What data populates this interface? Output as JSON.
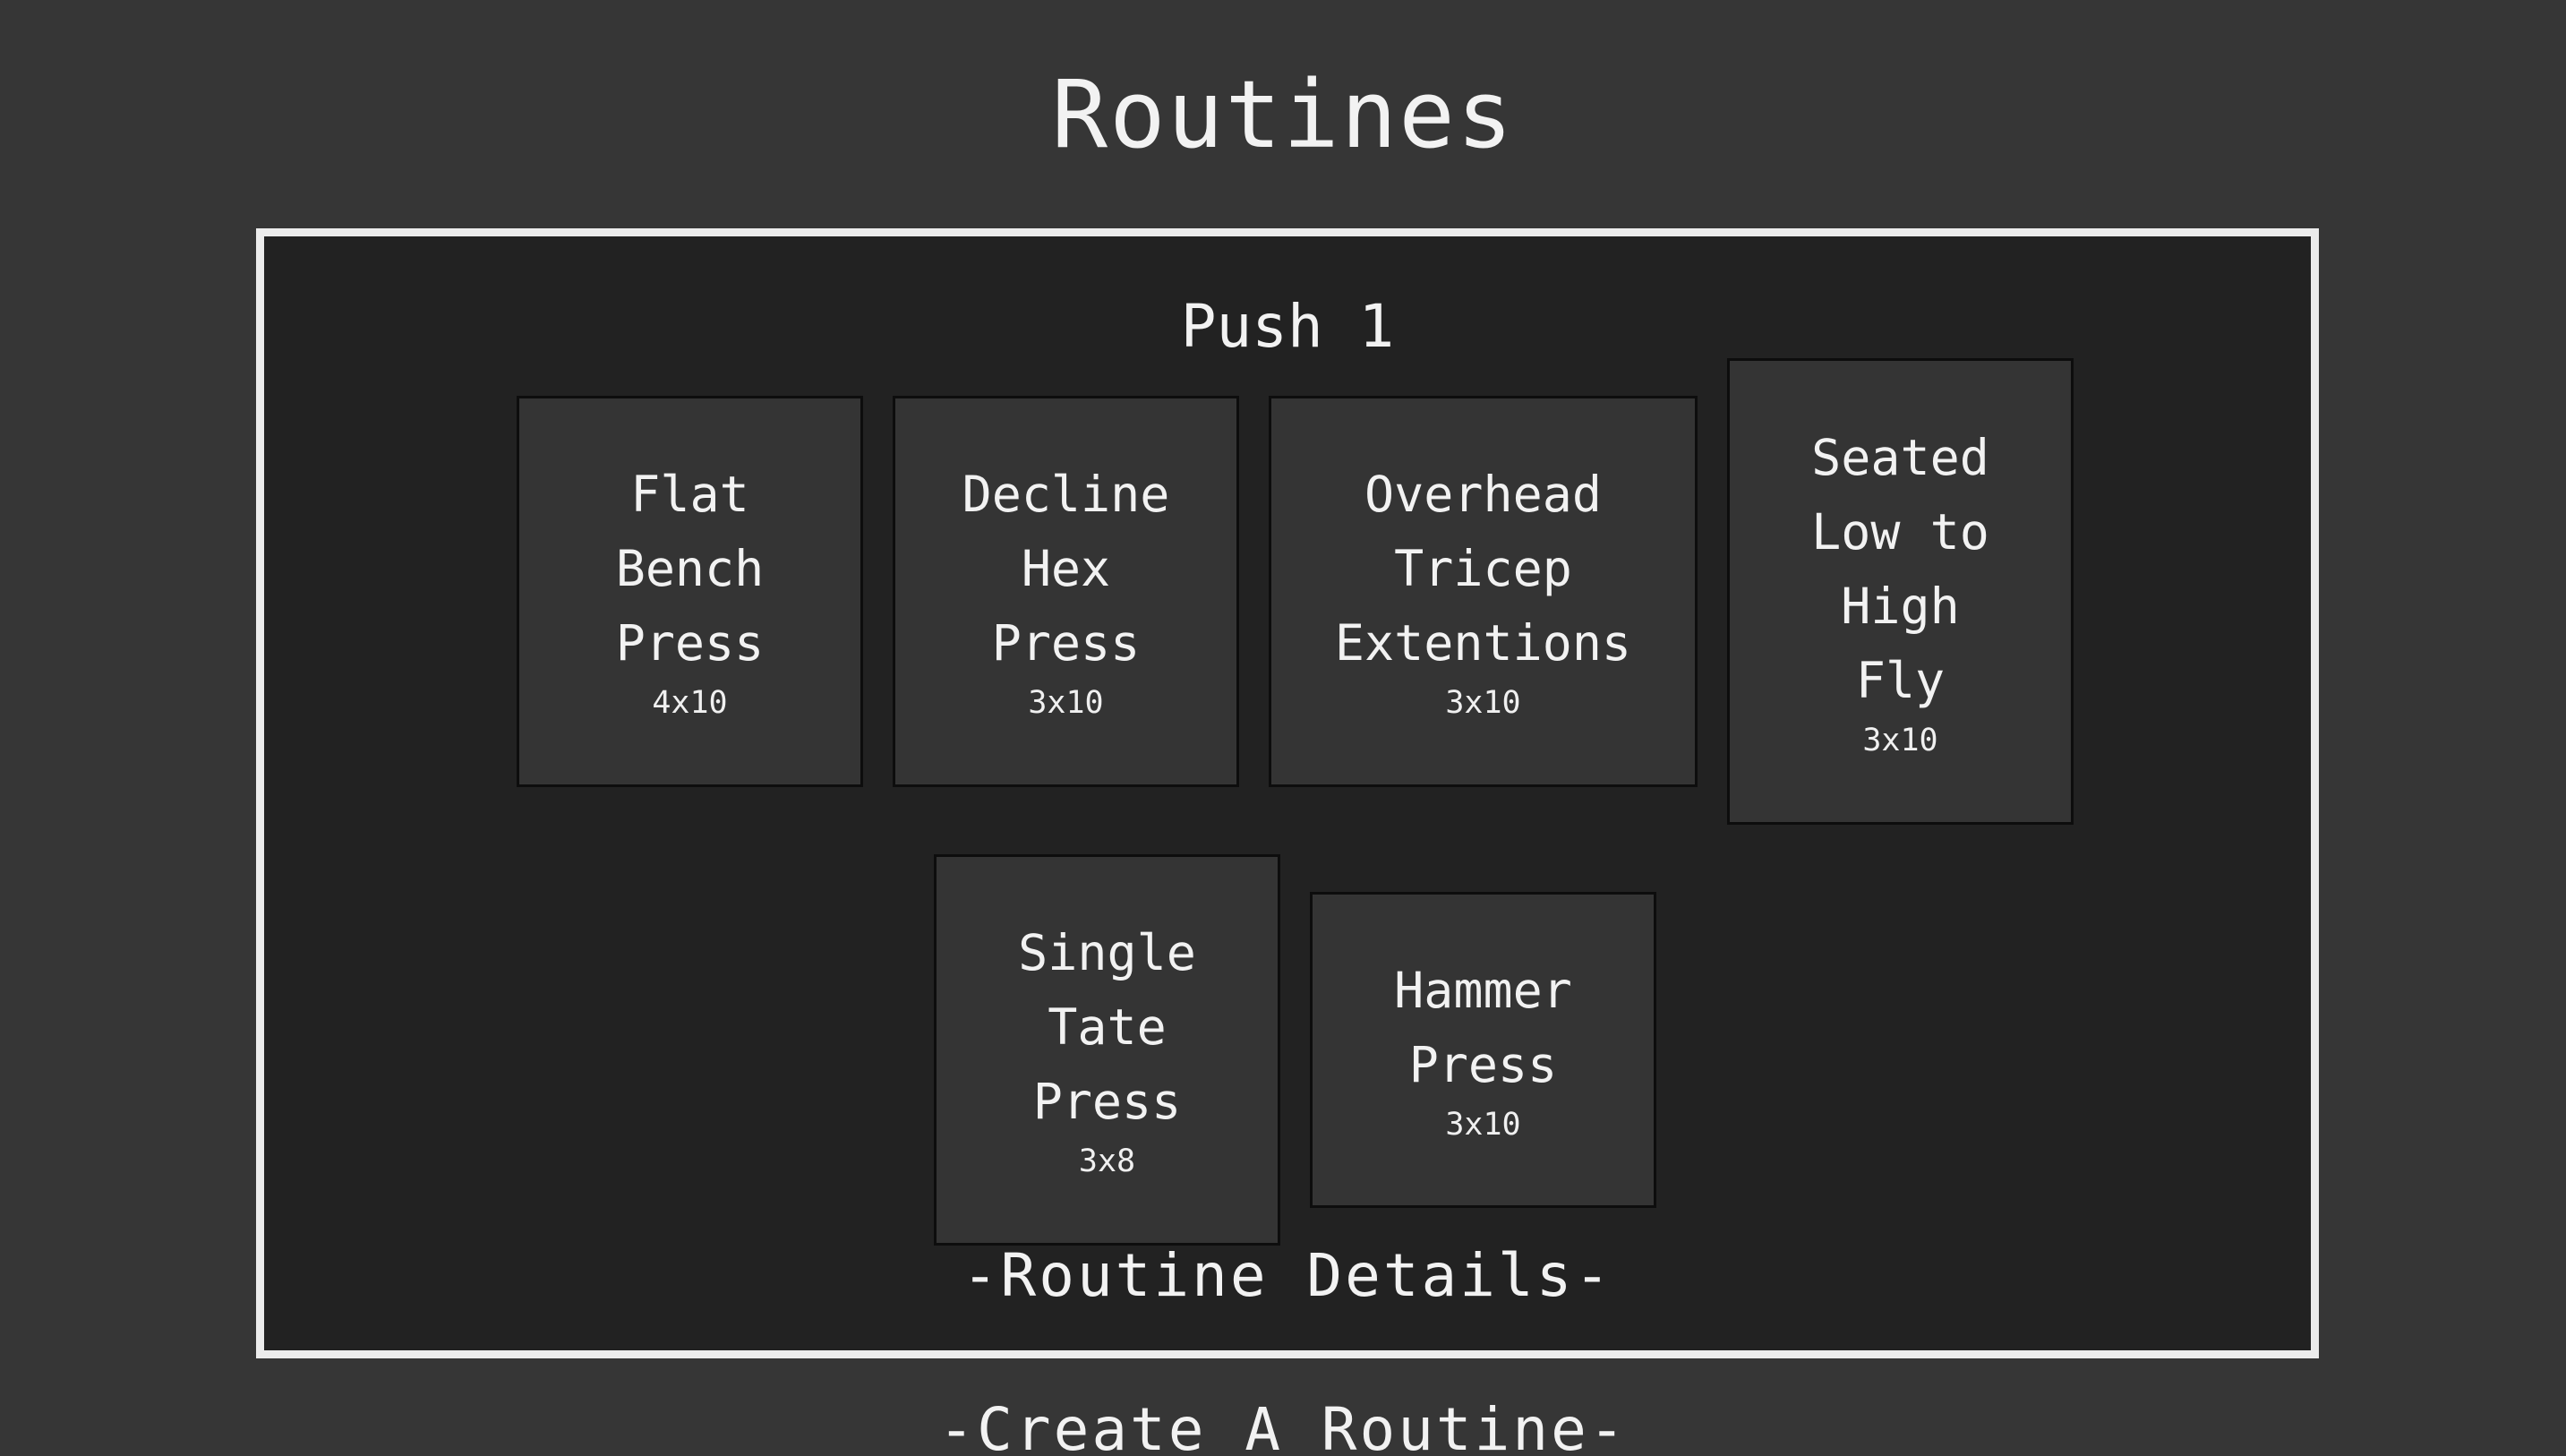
{
  "page": {
    "title": "Routines",
    "create_link": "-Create A Routine-"
  },
  "routine": {
    "name": "Push 1",
    "details_link": "-Routine Details-",
    "exercises": [
      {
        "name": "Flat\nBench\nPress",
        "sets": "4x10"
      },
      {
        "name": "Decline\nHex\nPress",
        "sets": "3x10"
      },
      {
        "name": "Overhead\nTricep\nExtentions",
        "sets": "3x10"
      },
      {
        "name": "Seated\nLow to\nHigh\nFly",
        "sets": "3x10"
      },
      {
        "name": "Single\nTate\nPress",
        "sets": "3x8"
      },
      {
        "name": "Hammer\nPress",
        "sets": "3x10"
      }
    ]
  },
  "colors": {
    "page_background": "#363636",
    "card_background": "#222222",
    "card_border": "#ececec",
    "exercise_background": "#343434",
    "text": "#f2f2f2"
  }
}
